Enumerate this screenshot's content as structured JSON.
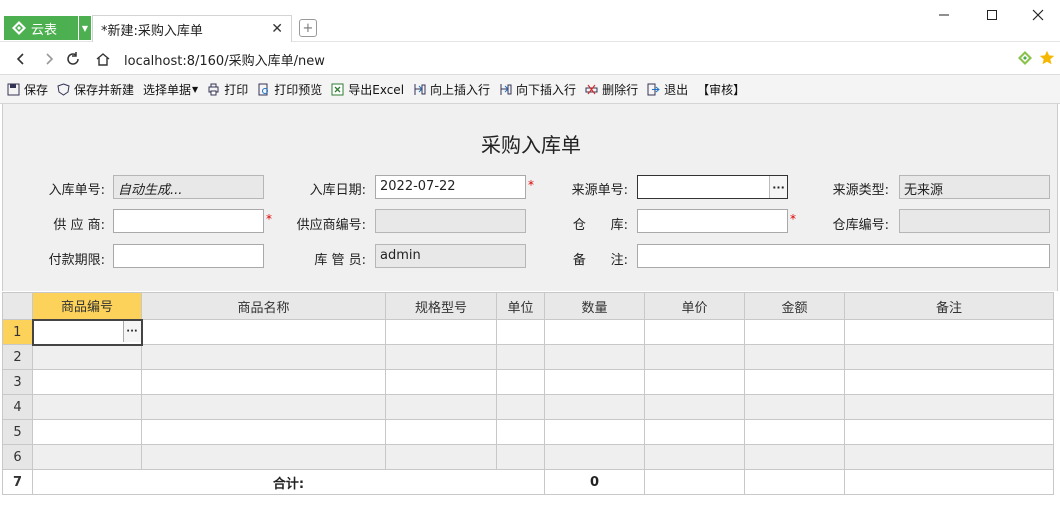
{
  "browser": {
    "app_label": "云表",
    "tab_title": "*新建:采购入库单",
    "url": "localhost:8/160/采购入库单/new",
    "colors": {
      "app_green": "#4caf50",
      "accent_yellow": "#fcd25a",
      "required_red": "#d00000"
    }
  },
  "toolbar": {
    "save": "保存",
    "save_new": "保存并新建",
    "select_doc": "选择单据",
    "print": "打印",
    "print_preview": "打印预览",
    "export_excel": "导出Excel",
    "insert_up": "向上插入行",
    "insert_down": "向下插入行",
    "delete_row": "删除行",
    "exit": "退出",
    "audit": "【审核】"
  },
  "form": {
    "title": "采购入库单",
    "doc_no_label": "入库单号:",
    "doc_no_value": "自动生成...",
    "date_label": "入库日期:",
    "date_value": "2022-07-22",
    "source_no_label": "来源单号:",
    "source_no_value": "",
    "source_type_label": "来源类型:",
    "source_type_value": "无来源",
    "supplier_label": "供 应 商:",
    "supplier_value": "",
    "supplier_code_label": "供应商编号:",
    "supplier_code_value": "",
    "warehouse_label": "仓      库:",
    "warehouse_value": "",
    "warehouse_code_label": "仓库编号:",
    "warehouse_code_value": "",
    "payment_term_label": "付款期限:",
    "payment_term_value": "",
    "keeper_label": "库 管 员:",
    "keeper_value": "admin",
    "remark_label": "备      注:",
    "remark_value": "",
    "required_mark": "*",
    "lookup_glyph": "···"
  },
  "grid": {
    "columns": [
      "商品编号",
      "商品名称",
      "规格型号",
      "单位",
      "数量",
      "单价",
      "金额",
      "备注"
    ],
    "row_numbers": [
      "1",
      "2",
      "3",
      "4",
      "5",
      "6",
      "7"
    ],
    "total_label": "合计:",
    "total_qty": "0"
  }
}
